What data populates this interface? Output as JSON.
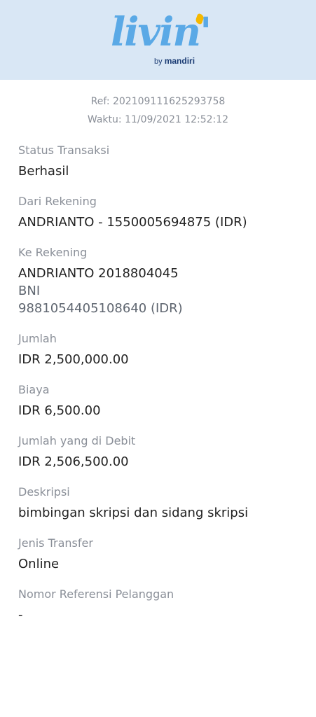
{
  "brand": {
    "logo_text": "livin'",
    "by_text": "by",
    "bank_text": "mandiri"
  },
  "meta": {
    "ref": "Ref: 202109111625293758",
    "time": "Waktu: 11/09/2021 12:52:12"
  },
  "fields": {
    "status": {
      "label": "Status Transaksi",
      "value": "Berhasil"
    },
    "from": {
      "label": "Dari Rekening",
      "value": "ANDRIANTO - 1550005694875 (IDR)"
    },
    "to": {
      "label": "Ke Rekening",
      "name_account": "ANDRIANTO 2018804045",
      "bank": "BNI",
      "account": "9881054405108640 (IDR)"
    },
    "amount": {
      "label": "Jumlah",
      "value": "IDR 2,500,000.00"
    },
    "fee": {
      "label": "Biaya",
      "value": "IDR 6,500.00"
    },
    "debited": {
      "label": "Jumlah yang di Debit",
      "value": "IDR 2,506,500.00"
    },
    "desc": {
      "label": "Deskripsi",
      "value": "bimbingan skripsi dan sidang skripsi"
    },
    "type": {
      "label": "Jenis Transfer",
      "value": "Online"
    },
    "custref": {
      "label": "Nomor Referensi Pelanggan",
      "value": "-"
    }
  },
  "colors": {
    "header_bg": "#d9e7f5",
    "logo_blue": "#5aa9e6",
    "logo_accent": "#f5b800",
    "label_gray": "#8a8f98"
  }
}
